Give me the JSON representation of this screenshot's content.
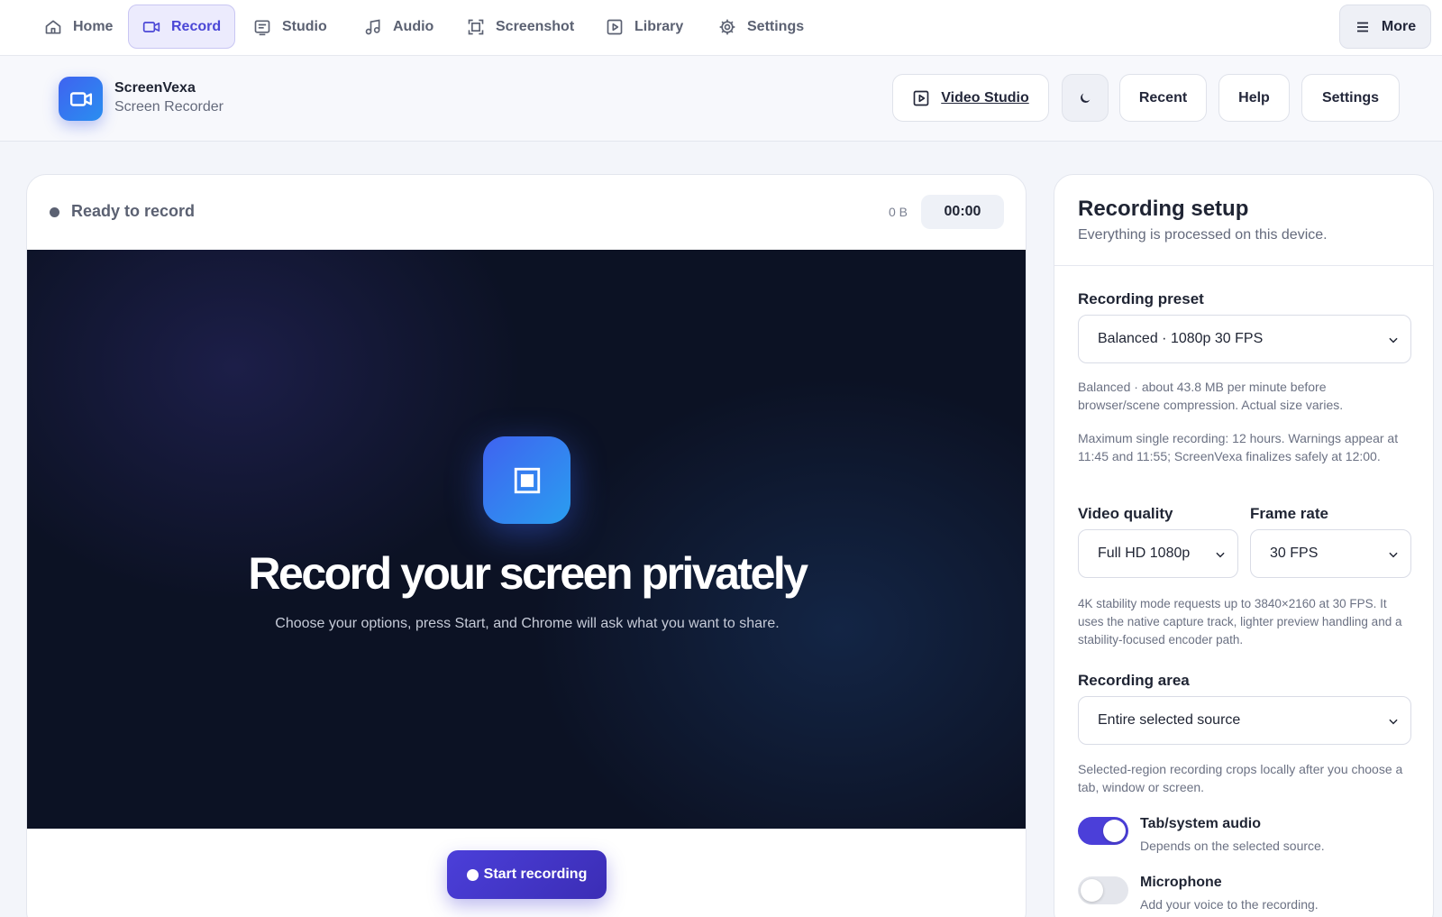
{
  "nav": {
    "items": [
      {
        "label": "Home",
        "icon": "home-icon"
      },
      {
        "label": "Record",
        "icon": "video-camera-icon",
        "active": true
      },
      {
        "label": "Studio",
        "icon": "studio-icon"
      },
      {
        "label": "Audio",
        "icon": "music-note-icon"
      },
      {
        "label": "Screenshot",
        "icon": "screenshot-frame-icon"
      },
      {
        "label": "Library",
        "icon": "play-square-icon"
      },
      {
        "label": "Settings",
        "icon": "gear-icon"
      }
    ],
    "more_label": "More"
  },
  "header": {
    "brand": "ScreenVexa",
    "subtitle": "Screen Recorder",
    "video_studio_label": "Video Studio",
    "recent_label": "Recent",
    "help_label": "Help",
    "settings_label": "Settings"
  },
  "recorder": {
    "status": "Ready to record",
    "size": "0 B",
    "timer": "00:00",
    "title": "Record your screen privately",
    "subtitle": "Choose your options, press Start, and Chrome will ask what you want to share.",
    "start_label": "Start recording"
  },
  "setup": {
    "title": "Recording setup",
    "subtitle": "Everything is processed on this device.",
    "preset_label": "Recording preset",
    "preset_value": "Balanced · 1080p 30 FPS",
    "preset_help": "Balanced · about 43.8 MB per minute before browser/scene compression. Actual size varies.",
    "limit_help": "Maximum single recording: 12 hours. Warnings appear at 11:45 and 11:55; ScreenVexa finalizes safely at 12:00.",
    "quality_label": "Video quality",
    "quality_value": "Full HD 1080p",
    "framerate_label": "Frame rate",
    "framerate_value": "30 FPS",
    "stability_help": "4K stability mode requests up to 3840×2160 at 30 FPS. It uses the native capture track, lighter preview handling and a stability-focused encoder path.",
    "area_label": "Recording area",
    "area_value": "Entire selected source",
    "area_help": "Selected-region recording crops locally after you choose a tab, window or screen.",
    "system_audio_title": "Tab/system audio",
    "system_audio_sub": "Depends on the selected source.",
    "system_audio_on": true,
    "mic_title": "Microphone",
    "mic_sub": "Add your voice to the recording.",
    "mic_on": false
  },
  "colors": {
    "accent": "#4b3fd9",
    "brand_blue": "#3f63f0",
    "stage_bg": "#0c1224"
  }
}
